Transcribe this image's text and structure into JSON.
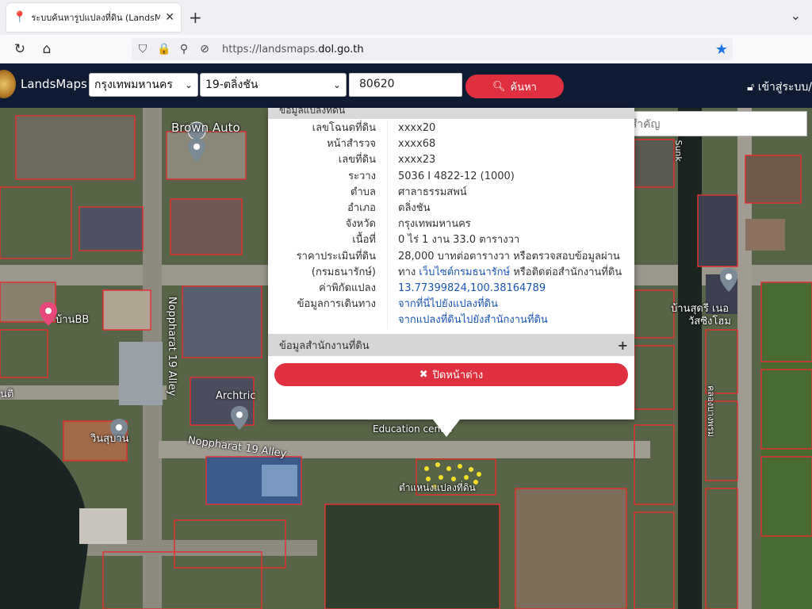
{
  "browser": {
    "tab_title": "ระบบค้นหารูปแปลงที่ดิน (LandsMaps)",
    "url_prefix": "https://landsmaps.",
    "url_domain": "dol.go.th"
  },
  "app": {
    "name": "LandsMaps",
    "province": "กรุงเทพมหานคร",
    "district": "19-ตลิ่งชัน",
    "parcel_no": "80620",
    "search_label": "ค้นหา",
    "login_label": "เข้าสู่ระบบ/"
  },
  "map": {
    "place_search_placeholder": "ค้นหาสถานที่สำคัญ",
    "labels": {
      "brown_auto": "Brown Auto",
      "baan_bb": "บ้านBB",
      "nopp_alley_vertical": "Noppharat 19 Alley",
      "nopp_alley_horizontal": "Noppharat 19 Alley",
      "archtric": "Archtric",
      "education_center": "Education center",
      "winsuban": "วินสุบาน",
      "nti": "นติ",
      "baan_sodsai": "บ้านสุดรี เนอ",
      "sod_sing": "วัสซิงโฮม",
      "parcel_location": "ตำแหน่งแปลงที่ดิน",
      "canal": "คลองบางพรม",
      "s_sunk": "S Sunk"
    }
  },
  "popup": {
    "header": "ข้อมูลแปลงที่ดิน",
    "rows": [
      {
        "k": "เลขโฉนดที่ดิน",
        "v": "xxxx20"
      },
      {
        "k": "หน้าสำรวจ",
        "v": "xxxx68"
      },
      {
        "k": "เลขที่ดิน",
        "v": "xxxx23"
      },
      {
        "k": "ระวาง",
        "v": "5036 I 4822-12 (1000)"
      },
      {
        "k": "ตำบล",
        "v": "ศาลาธรรมสพน์"
      },
      {
        "k": "อำเภอ",
        "v": "ตลิ่งชัน"
      },
      {
        "k": "จังหวัด",
        "v": "กรุงเทพมหานคร"
      },
      {
        "k": "เนื้อที่",
        "v": "0 ไร่ 1 งาน 33.0 ตารางวา"
      },
      {
        "k": "ราคาประเมินที่ดิน",
        "v": "28,000 บาทต่อตารางวา หรือตรวจสอบข้อมูลผ่าน"
      }
    ],
    "row_treasury_k": "(กรมธนารักษ์)",
    "row_treasury_v1": "ทาง ",
    "row_treasury_link": "เว็บไซต์กรมธนารักษ์",
    "row_treasury_v2": " หรือติดต่อสำนักงานที่ดิน",
    "coord_k": "ค่าพิกัดแปลง",
    "coord_v": "13.77399824,100.38164789",
    "travel_k": "ข้อมูลการเดินทาง",
    "travel_link1": "จากที่นี่ไปยังแปลงที่ดิน",
    "travel_link2": "จากแปลงที่ดินไปยังสำนักงานที่ดิน",
    "office_section": "ข้อมูลสำนักงานที่ดิน",
    "office_plus": "+",
    "close_label": "ปิดหน้าต่าง"
  }
}
